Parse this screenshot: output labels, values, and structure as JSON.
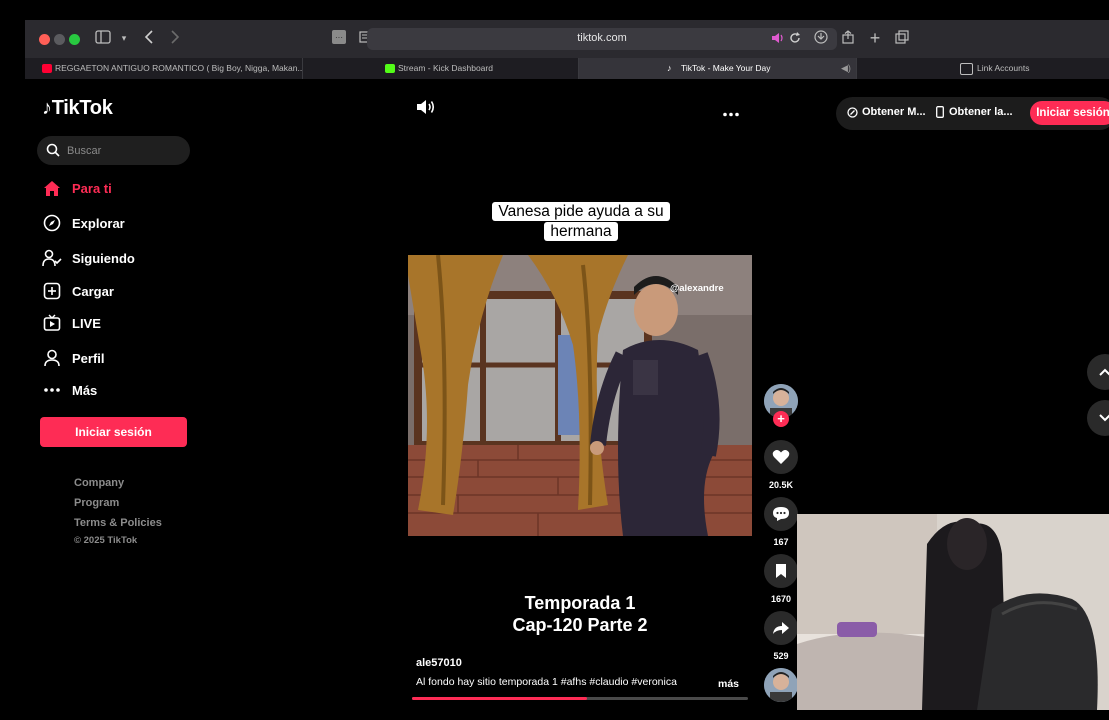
{
  "browser": {
    "url": "tiktok.com",
    "tabs": [
      {
        "label": "REGGAETON ANTIGUO ROMANTICO ( Big Boy, Nigga, Makan..."
      },
      {
        "label": "Stream - Kick Dashboard"
      },
      {
        "label": "TikTok - Make Your Day"
      },
      {
        "label": "Link Accounts"
      }
    ]
  },
  "sidebar": {
    "logo": "TikTok",
    "search_placeholder": "Buscar",
    "nav": [
      {
        "label": "Para ti",
        "icon": "home-icon"
      },
      {
        "label": "Explorar",
        "icon": "compass-icon"
      },
      {
        "label": "Siguiendo",
        "icon": "following-icon"
      },
      {
        "label": "Cargar",
        "icon": "upload-icon"
      },
      {
        "label": "LIVE",
        "icon": "live-icon"
      },
      {
        "label": "Perfil",
        "icon": "profile-icon"
      },
      {
        "label": "Más",
        "icon": "more-icon"
      }
    ],
    "login_label": "Iniciar sesión",
    "footer": {
      "company": "Company",
      "program": "Program",
      "terms": "Terms & Policies",
      "copyright": "© 2025 TikTok"
    }
  },
  "topbar": {
    "get_app_1": "Obtener M...",
    "get_app_2": "Obtener la...",
    "login_label": "Iniciar sesión"
  },
  "video": {
    "caption": "Vanesa pide ayuda a su hermana",
    "watermark": "@alexandre",
    "title_line1": "Temporada 1",
    "title_line2": "Cap-120 Parte 2",
    "author": "ale57010",
    "description": "Al fondo hay sitio temporada 1 #afhs  #claudio  #veronica",
    "more_label": "más",
    "progress": 0.52
  },
  "actions": {
    "likes": "20.5K",
    "comments": "167",
    "saves": "1670",
    "shares": "529"
  },
  "colors": {
    "accent": "#fe2c55",
    "background": "#000000"
  }
}
